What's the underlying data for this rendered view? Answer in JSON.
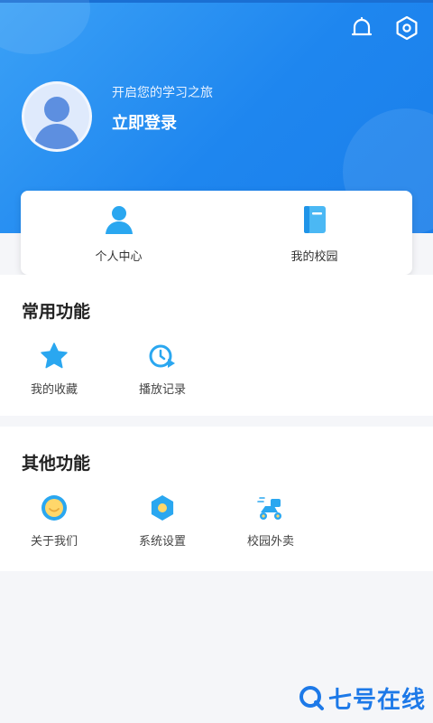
{
  "header": {
    "subtitle": "开启您的学习之旅",
    "login_label": "立即登录",
    "icons": [
      "bell-icon",
      "settings-hex-icon"
    ],
    "gradient": [
      "#3ba1f6",
      "#1b7fea"
    ]
  },
  "quick_links": [
    {
      "label": "个人中心",
      "icon": "person-icon"
    },
    {
      "label": "我的校园",
      "icon": "book-icon"
    }
  ],
  "common": {
    "title": "常用功能",
    "items": [
      {
        "label": "我的收藏",
        "icon": "star-icon"
      },
      {
        "label": "播放记录",
        "icon": "clock-play-icon"
      }
    ]
  },
  "other": {
    "title": "其他功能",
    "items": [
      {
        "label": "关于我们",
        "icon": "about-icon"
      },
      {
        "label": "系统设置",
        "icon": "hexagon-settings-icon"
      },
      {
        "label": "校园外卖",
        "icon": "delivery-scooter-icon"
      }
    ]
  },
  "watermark": {
    "text": "七号在线"
  },
  "colors": {
    "accent": "#1d86ef",
    "icon_blue": "#2aa7f0",
    "icon_yellow": "#ffd76a"
  }
}
